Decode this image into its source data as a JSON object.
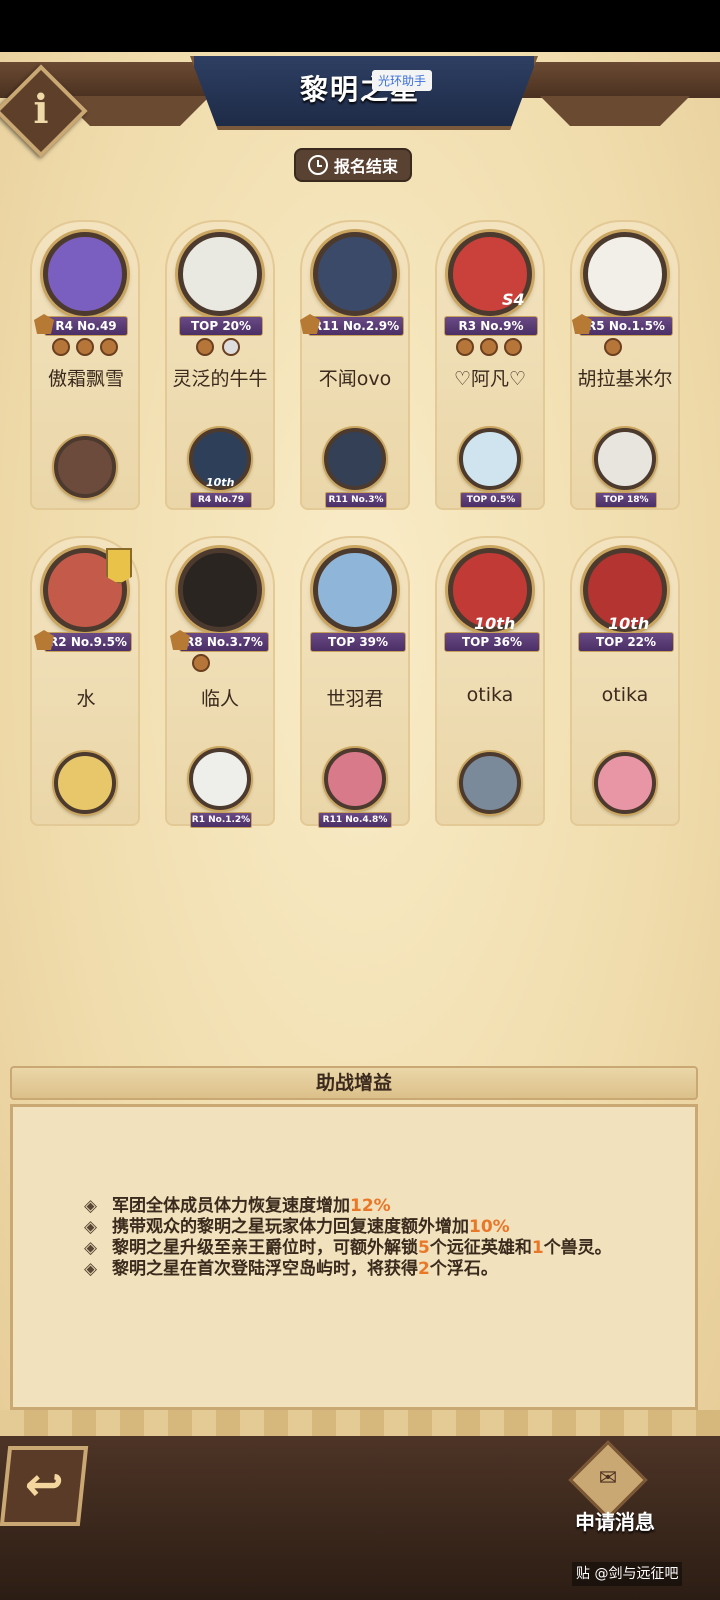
{
  "header": {
    "title": "黎明之星",
    "watermark": "光环助手",
    "info_label": "i"
  },
  "status": {
    "label": "报名结束",
    "icon": "clock-icon"
  },
  "slots": [
    {
      "name": "傲霜飘雪",
      "badge": "R4 No.49",
      "sub_badge": "",
      "color": "#7b5fc0"
    },
    {
      "name": "灵泛的牛牛",
      "badge": "TOP 20%",
      "sub_badge": "R4 No.79",
      "color": "#e9e9e2"
    },
    {
      "name": "不闻ovo",
      "badge": "R11 No.2.9%",
      "sub_badge": "R11 No.3%",
      "color": "#3a4a68"
    },
    {
      "name": "♡阿凡♡",
      "badge": "R3 No.9%",
      "sub_badge": "TOP 0.5%",
      "color": "#c9413a"
    },
    {
      "name": "胡拉基米尔",
      "badge": "R5 No.1.5%",
      "sub_badge": "TOP 18%",
      "color": "#f2efe8"
    },
    {
      "name": "水",
      "badge": "R2 No.9.5%",
      "sub_badge": "",
      "color": "#c45a4a"
    },
    {
      "name": "临人",
      "badge": "R8 No.3.7%",
      "sub_badge": "R1 No.1.2%",
      "color": "#2a2520"
    },
    {
      "name": "世羽君",
      "badge": "TOP 39%",
      "sub_badge": "R11 No.4.8%",
      "color": "#8fb5d8"
    },
    {
      "name": "otika",
      "badge": "TOP 36%",
      "sub_badge": "",
      "color": "#c23a35"
    },
    {
      "name": "otika",
      "badge": "TOP 22%",
      "sub_badge": "",
      "color": "#b33430"
    }
  ],
  "labels": {
    "rank_10th": "10th",
    "s4": "S4"
  },
  "panel": {
    "title": "助战增益",
    "buffs": [
      {
        "pre": "军团全体成员体力恢复速度增加",
        "hl": "12%",
        "post": ""
      },
      {
        "pre": "携带观众的黎明之星玩家体力回复速度额外增加",
        "hl": "10%",
        "post": ""
      },
      {
        "pre": "黎明之星升级至亲王爵位时，可额外解锁",
        "hl": "5",
        "post": "个远征英雄和",
        "hl2": "1",
        "post2": "个兽灵。"
      },
      {
        "pre": "黎明之星在首次登陆浮空岛屿时，将获得",
        "hl": "2",
        "post": "个浮石。"
      }
    ],
    "bullet": "◈"
  },
  "footer": {
    "back_label": "↩",
    "message_label": "申请消息",
    "watermark": "贴 @剑与远征吧"
  },
  "colors": {
    "highlight": "#e8772a",
    "parchment": "#f1deaf"
  }
}
